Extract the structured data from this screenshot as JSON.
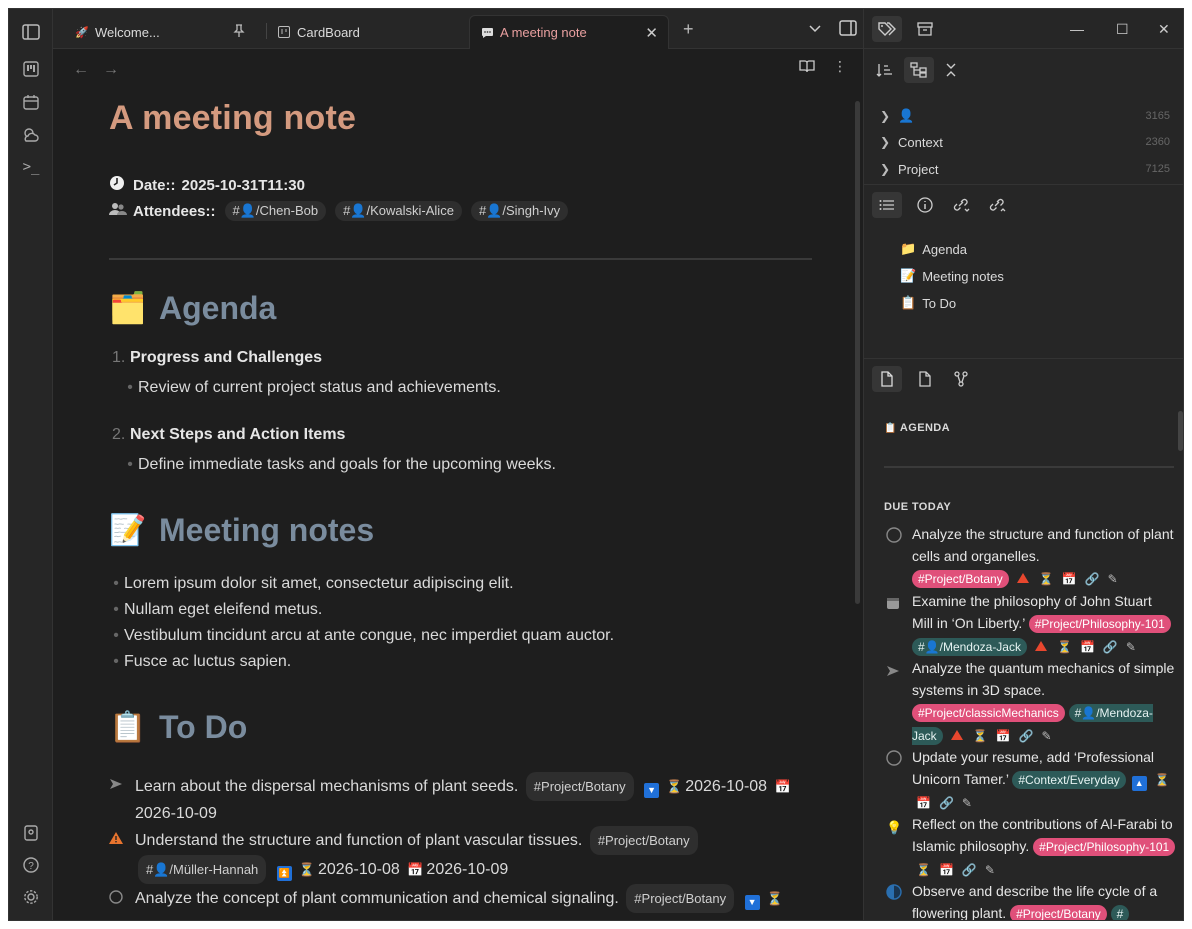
{
  "tabs": [
    {
      "label": "Welcome...",
      "icon": "rocket-icon"
    },
    {
      "label": "CardBoard",
      "icon": "cardboard-icon"
    },
    {
      "label": "A meeting note",
      "icon": "chat-icon"
    }
  ],
  "note": {
    "title": "A meeting note",
    "date_label": "Date::",
    "date_value": "2025-10-31T11:30",
    "attendees_label": "Attendees::",
    "attendees": [
      "#👤/Chen-Bob",
      "#👤/Kowalski-Alice",
      "#👤/Singh-Ivy"
    ],
    "agenda_heading": "Agenda",
    "agenda_emoji": "🗂️",
    "agenda": [
      {
        "num": "1.",
        "title": "Progress and Challenges",
        "detail": "Review of current project status and achievements."
      },
      {
        "num": "2.",
        "title": "Next Steps and Action Items",
        "detail": "Define immediate tasks and goals for the upcoming weeks."
      }
    ],
    "notes_heading": "Meeting notes",
    "notes_emoji": "📝",
    "notes": [
      "Lorem ipsum dolor sit amet, consectetur adipiscing elit.",
      "Nullam eget eleifend metus.",
      "Vestibulum tincidunt arcu at ante congue, nec imperdiet quam auctor.",
      "Fusce ac luctus sapien."
    ],
    "todo_heading": "To Do",
    "todo_emoji": "📋",
    "todos": [
      {
        "text": "Learn about the dispersal mechanisms of plant seeds.",
        "tag": "#Project/Botany",
        "date1": "2026-10-08",
        "date2": "2026-10-09"
      },
      {
        "text": "Understand the structure and function of plant vascular tissues.",
        "tag": "#Project/Botany",
        "tag2": "#👤/Müller-Hannah",
        "date1": "2026-10-08",
        "date2": "2026-10-09"
      },
      {
        "text": "Analyze the concept of plant communication and chemical signaling.",
        "tag": "#Project/Botany"
      }
    ]
  },
  "tree": [
    {
      "label": "👤",
      "count": "3165"
    },
    {
      "label": "Context",
      "count": "2360"
    },
    {
      "label": "Project",
      "count": "7125"
    }
  ],
  "outline": [
    {
      "icon": "📁",
      "label": "Agenda"
    },
    {
      "icon": "📝",
      "label": "Meeting notes"
    },
    {
      "icon": "📋",
      "label": "To Do"
    }
  ],
  "tasks_panel": {
    "header": "AGENDA",
    "header_icon": "📋",
    "due_label": "DUE TODAY",
    "tasks": [
      {
        "text": "Analyze the structure and function of plant cells and organelles.",
        "tags": [
          "#Project/Botany"
        ]
      },
      {
        "text": "Examine the philosophy of John Stuart Mill in ‘On Liberty.’",
        "tags": [
          "#Project/Philosophy-101",
          "#👤/Mendoza-Jack"
        ]
      },
      {
        "text": "Analyze the quantum mechanics of simple systems in 3D space.",
        "tags": [
          "#Project/classicMechanics",
          "#👤/Mendoza-Jack"
        ]
      },
      {
        "text": "Update your resume, add ‘Professional Unicorn Tamer.’",
        "tags": [
          "#Context/Everyday"
        ]
      },
      {
        "text": "Reflect on the contributions of Al-Farabi to Islamic philosophy.",
        "tags": [
          "#Project/Philosophy-101"
        ]
      },
      {
        "text": "Observe and describe the life cycle of a flowering plant.",
        "tags": [
          "#Project/Botany",
          "#"
        ]
      }
    ]
  },
  "colors": {
    "title": "#d49a7f",
    "heading": "#7a8c9e",
    "active_tab": "#e9a0a0",
    "project_tag": "#e0507a",
    "person_tag": "#2d5a58",
    "priority": "#e8472e"
  }
}
